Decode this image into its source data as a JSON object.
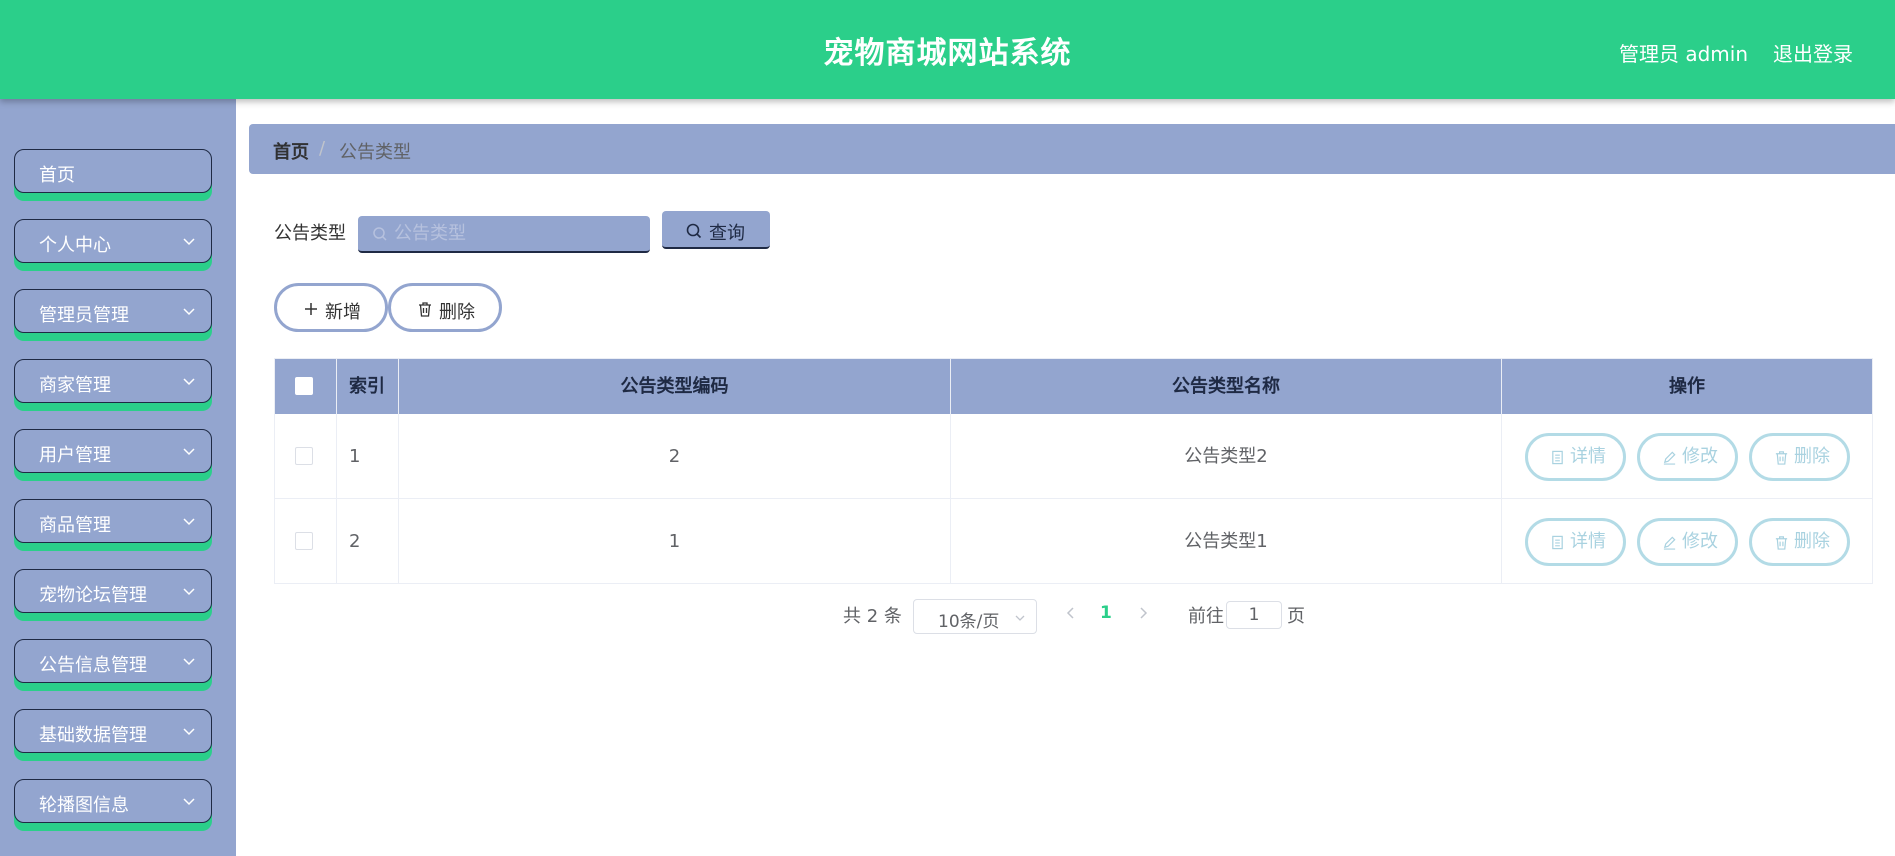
{
  "header": {
    "title": "宠物商城网站系统",
    "user": "管理员 admin",
    "logout": "退出登录"
  },
  "sidebar": {
    "items": [
      {
        "label": "首页",
        "expandable": false
      },
      {
        "label": "个人中心",
        "expandable": true
      },
      {
        "label": "管理员管理",
        "expandable": true
      },
      {
        "label": "商家管理",
        "expandable": true
      },
      {
        "label": "用户管理",
        "expandable": true
      },
      {
        "label": "商品管理",
        "expandable": true
      },
      {
        "label": "宠物论坛管理",
        "expandable": true
      },
      {
        "label": "公告信息管理",
        "expandable": true
      },
      {
        "label": "基础数据管理",
        "expandable": true
      },
      {
        "label": "轮播图信息",
        "expandable": true
      }
    ]
  },
  "breadcrumb": {
    "home": "首页",
    "separator": "/",
    "current": "公告类型"
  },
  "search": {
    "label": "公告类型",
    "placeholder": "公告类型",
    "value": "",
    "button": "查询"
  },
  "actions": {
    "add": "新增",
    "delete": "删除"
  },
  "table": {
    "columns": [
      "索引",
      "公告类型编码",
      "公告类型名称",
      "操作"
    ],
    "rows": [
      {
        "index": "1",
        "code": "2",
        "name": "公告类型2"
      },
      {
        "index": "2",
        "code": "1",
        "name": "公告类型1"
      }
    ],
    "row_actions": {
      "detail": "详情",
      "edit": "修改",
      "delete": "删除"
    }
  },
  "pagination": {
    "total": "共 2 条",
    "page_size": "10条/页",
    "current": "1",
    "goto_label": "前往",
    "goto_value": "1",
    "page_suffix": "页"
  },
  "colors": {
    "accent": "#2bcf8a",
    "panel": "#93a5cf",
    "muted_border": "#b3dbe6"
  }
}
